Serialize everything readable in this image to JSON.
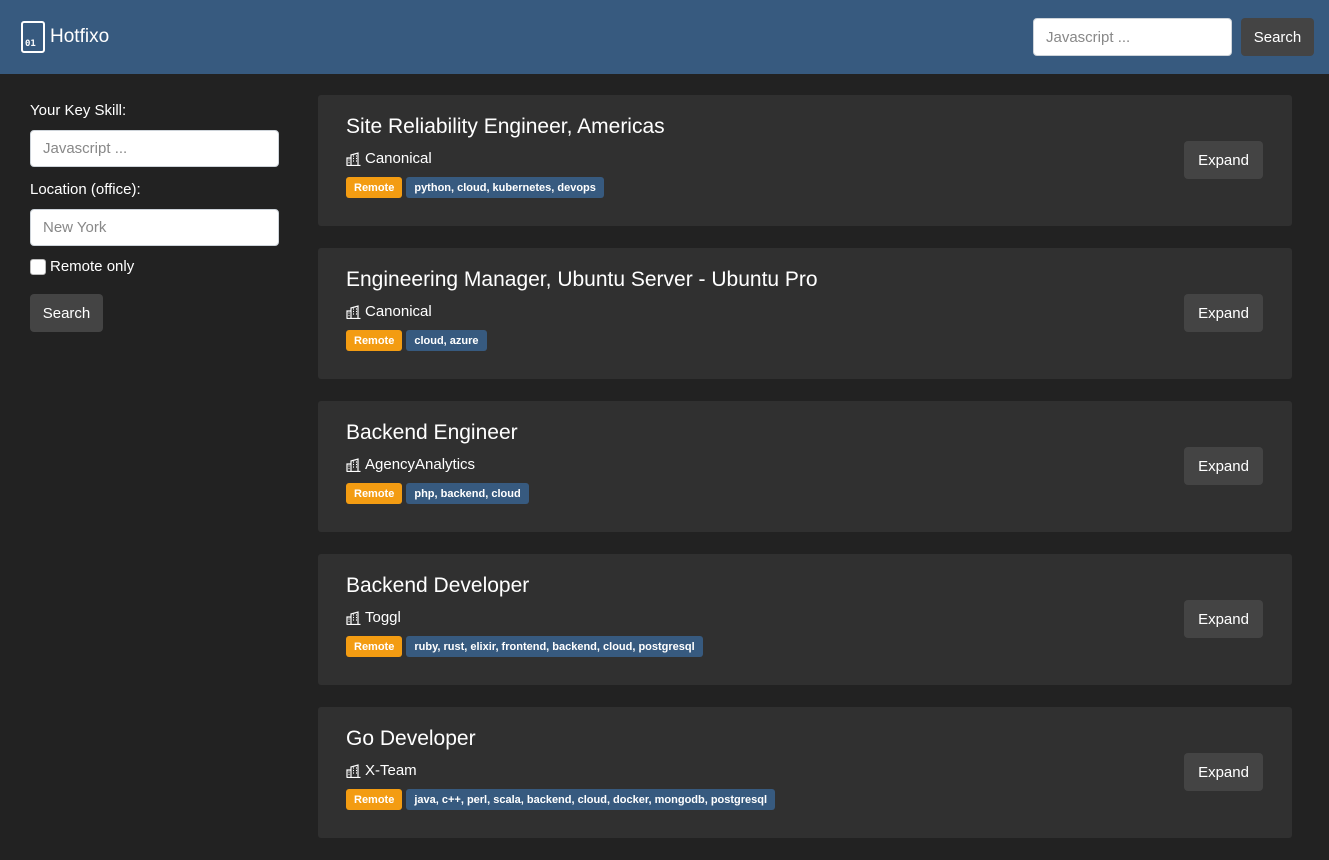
{
  "brand": {
    "icon_text": "01",
    "name": "Hotfixo"
  },
  "navbar": {
    "search_placeholder": "Javascript ...",
    "search_label": "Search"
  },
  "sidebar": {
    "skill_label": "Your Key Skill:",
    "skill_placeholder": "Javascript ...",
    "location_label": "Location (office):",
    "location_placeholder": "New York",
    "remote_label": "Remote only",
    "search_label": "Search"
  },
  "jobs": [
    {
      "title": "Site Reliability Engineer, Americas",
      "company": "Canonical",
      "remote": "Remote",
      "skills": "python, cloud, kubernetes, devops",
      "expand": "Expand"
    },
    {
      "title": "Engineering Manager, Ubuntu Server - Ubuntu Pro",
      "company": "Canonical",
      "remote": "Remote",
      "skills": "cloud, azure",
      "expand": "Expand"
    },
    {
      "title": "Backend Engineer",
      "company": "AgencyAnalytics",
      "remote": "Remote",
      "skills": "php, backend, cloud",
      "expand": "Expand"
    },
    {
      "title": "Backend Developer",
      "company": "Toggl",
      "remote": "Remote",
      "skills": "ruby, rust, elixir, frontend, backend, cloud, postgresql",
      "expand": "Expand"
    },
    {
      "title": "Go Developer",
      "company": "X-Team",
      "remote": "Remote",
      "skills": "java, c++, perl, scala, backend, cloud, docker, mongodb, postgresql",
      "expand": "Expand"
    }
  ],
  "colors": {
    "navbar": "#375a7f",
    "background": "#222222",
    "card": "#303030",
    "remote_badge": "#f39c12",
    "skill_badge": "#375a7f",
    "button": "#444444"
  },
  "icons": {
    "brand": "binary-file-icon",
    "company": "building-icon"
  }
}
